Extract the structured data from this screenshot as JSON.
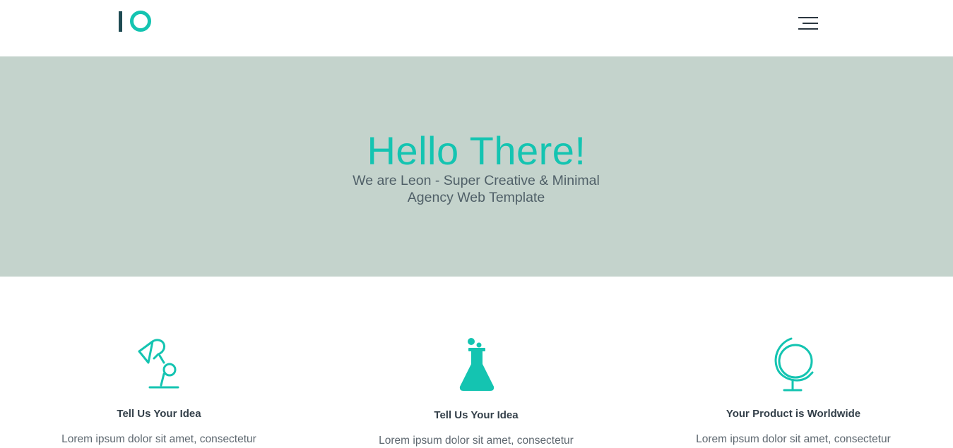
{
  "header": {
    "logo_alt": "IO logo",
    "menu_icon": "hamburger-menu-icon"
  },
  "hero": {
    "title": "Hello There!",
    "subtitle": "We are Leon - Super Creative & Minimal Agency Web Template"
  },
  "features": [
    {
      "icon": "desk-lamp-icon",
      "title": "Tell Us Your Idea",
      "text": "Lorem ipsum dolor sit amet, consectetur"
    },
    {
      "icon": "flask-icon",
      "title": "Tell Us Your Idea",
      "text": "Lorem ipsum dolor sit amet, consectetur"
    },
    {
      "icon": "globe-icon",
      "title": "Your Product is Worldwide",
      "text": "Lorem ipsum dolor sit amet, consectetur"
    }
  ],
  "colors": {
    "accent": "#14c4b1",
    "hero_bg": "#c4d3cc",
    "logo_dark": "#1f4b53",
    "text_dark": "#34404a"
  }
}
